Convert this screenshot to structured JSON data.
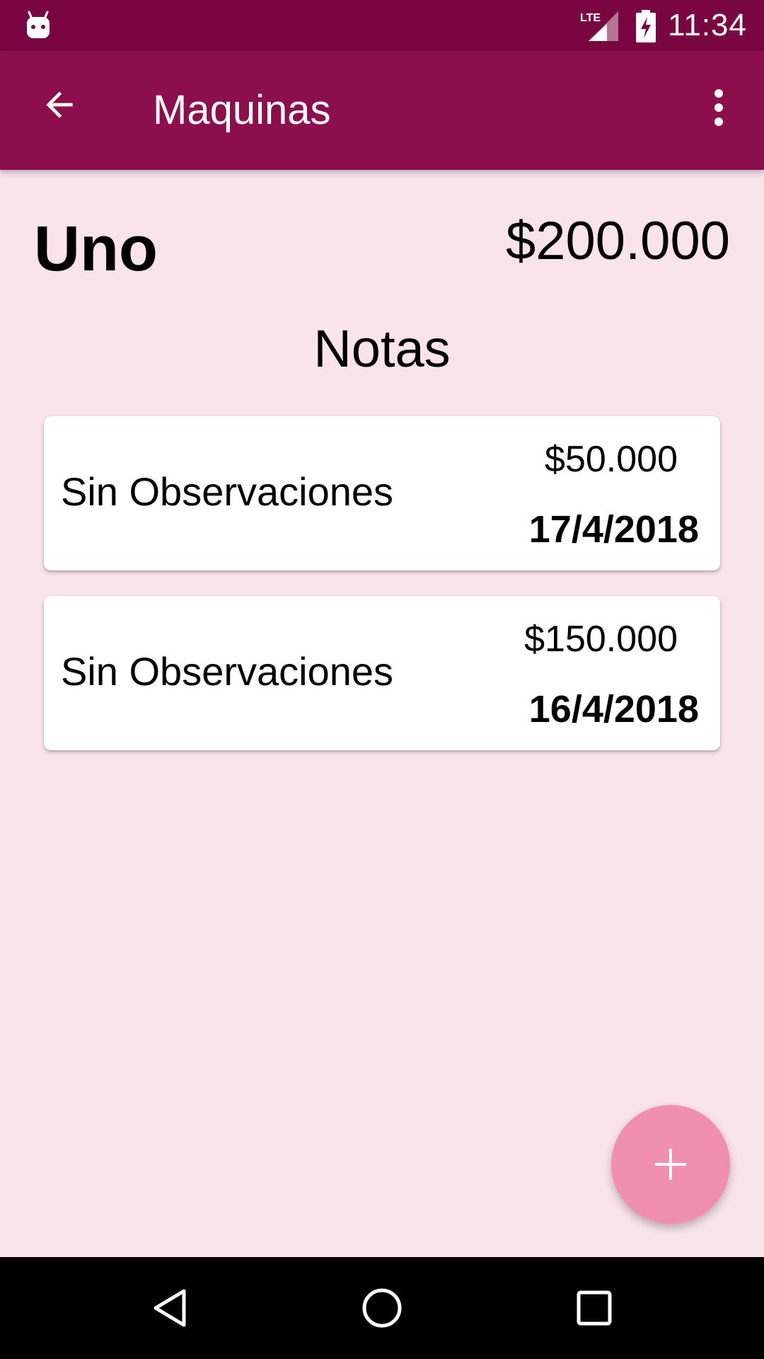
{
  "status_bar": {
    "time": "11:34",
    "network": "LTE",
    "icons": [
      "android-icon",
      "lte-signal-icon",
      "battery-charging-icon"
    ]
  },
  "app_bar": {
    "title": "Maquinas",
    "back_icon": "arrow-back-icon",
    "menu_icon": "more-vertical-icon",
    "color": "#8B0F4D"
  },
  "machine": {
    "name": "Uno",
    "total": "$200.000"
  },
  "notes_section": {
    "title": "Notas",
    "items": [
      {
        "observation": "Sin Observaciones",
        "amount": "$50.000",
        "date": "17/4/2018"
      },
      {
        "observation": "Sin Observaciones",
        "amount": "$150.000",
        "date": "16/4/2018"
      }
    ]
  },
  "fab": {
    "icon": "plus-icon",
    "color": "#F18FB0"
  },
  "nav_bar": {
    "buttons": [
      "back-triangle-icon",
      "home-circle-icon",
      "recents-square-icon"
    ]
  },
  "colors": {
    "status_bar": "#790641",
    "background": "#FAE4EC"
  }
}
